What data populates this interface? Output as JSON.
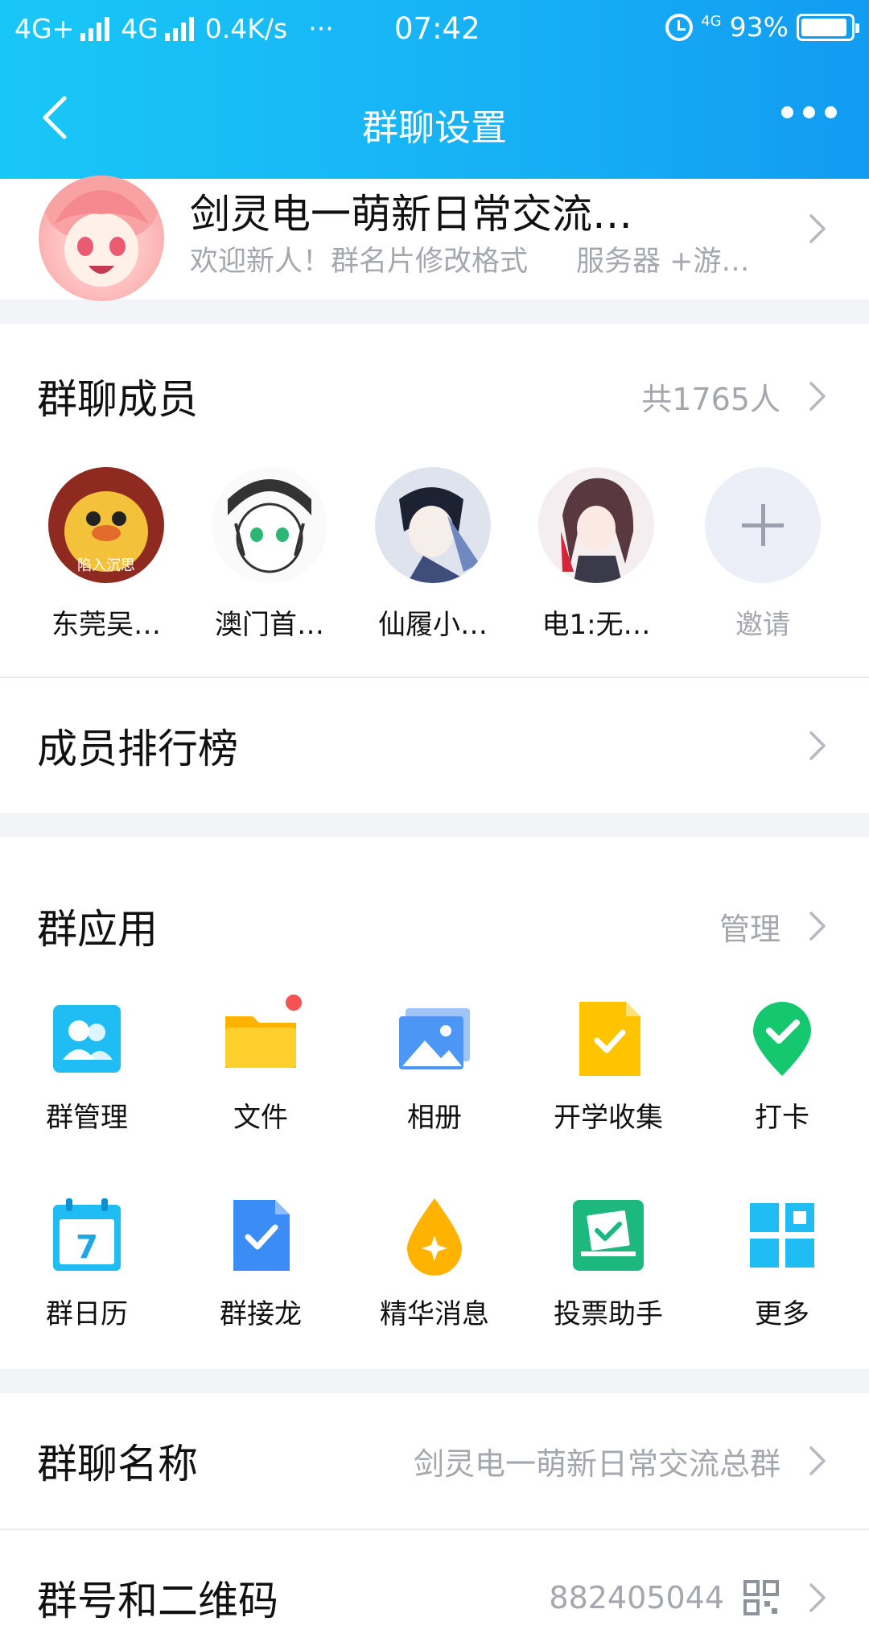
{
  "status_bar": {
    "network_left": "4G+",
    "network_right": "4G",
    "speed": "0.4K/s",
    "more": "···",
    "time": "07:42",
    "net_small": "4G",
    "battery": "93%",
    "battery_level": 0.93
  },
  "nav": {
    "title": "群聊设置",
    "back_icon": "chevron-left-icon",
    "more_icon": "more-dots-icon"
  },
  "group": {
    "name": "剑灵电一萌新日常交流…",
    "desc_part1": "欢迎新人！群名片修改格式",
    "desc_part2": "服务器 +游…"
  },
  "members": {
    "title": "群聊成员",
    "count": "共1765人",
    "list": [
      {
        "name": "东莞吴…",
        "avatar_text": "陷入沉思",
        "color": "#e8b42a"
      },
      {
        "name": "澳门首…",
        "color": "#f5f5f5"
      },
      {
        "name": "仙履小…",
        "color": "#5b6a8f"
      },
      {
        "name": "电1:无…",
        "color": "#e8a3b0"
      },
      {
        "name": "邀请"
      }
    ]
  },
  "ranking": {
    "title": "成员排行榜"
  },
  "apps": {
    "title": "群应用",
    "manage": "管理",
    "items": [
      {
        "label": "群管理",
        "icon": "group-manage-icon"
      },
      {
        "label": "文件",
        "icon": "folder-icon"
      },
      {
        "label": "相册",
        "icon": "album-icon"
      },
      {
        "label": "开学收集",
        "icon": "collect-icon"
      },
      {
        "label": "打卡",
        "icon": "checkin-icon"
      },
      {
        "label": "群日历",
        "icon": "calendar-icon"
      },
      {
        "label": "群接龙",
        "icon": "relay-icon"
      },
      {
        "label": "精华消息",
        "icon": "essence-icon"
      },
      {
        "label": "投票助手",
        "icon": "vote-icon"
      },
      {
        "label": "更多",
        "icon": "more-apps-icon"
      }
    ]
  },
  "group_name_row": {
    "title": "群聊名称",
    "value": "剑灵电一萌新日常交流总群"
  },
  "group_id_row": {
    "title": "群号和二维码",
    "value": "882405044"
  },
  "colors": {
    "header_start": "#19c7f7",
    "header_end": "#129bf2",
    "badge": "#f35452"
  }
}
